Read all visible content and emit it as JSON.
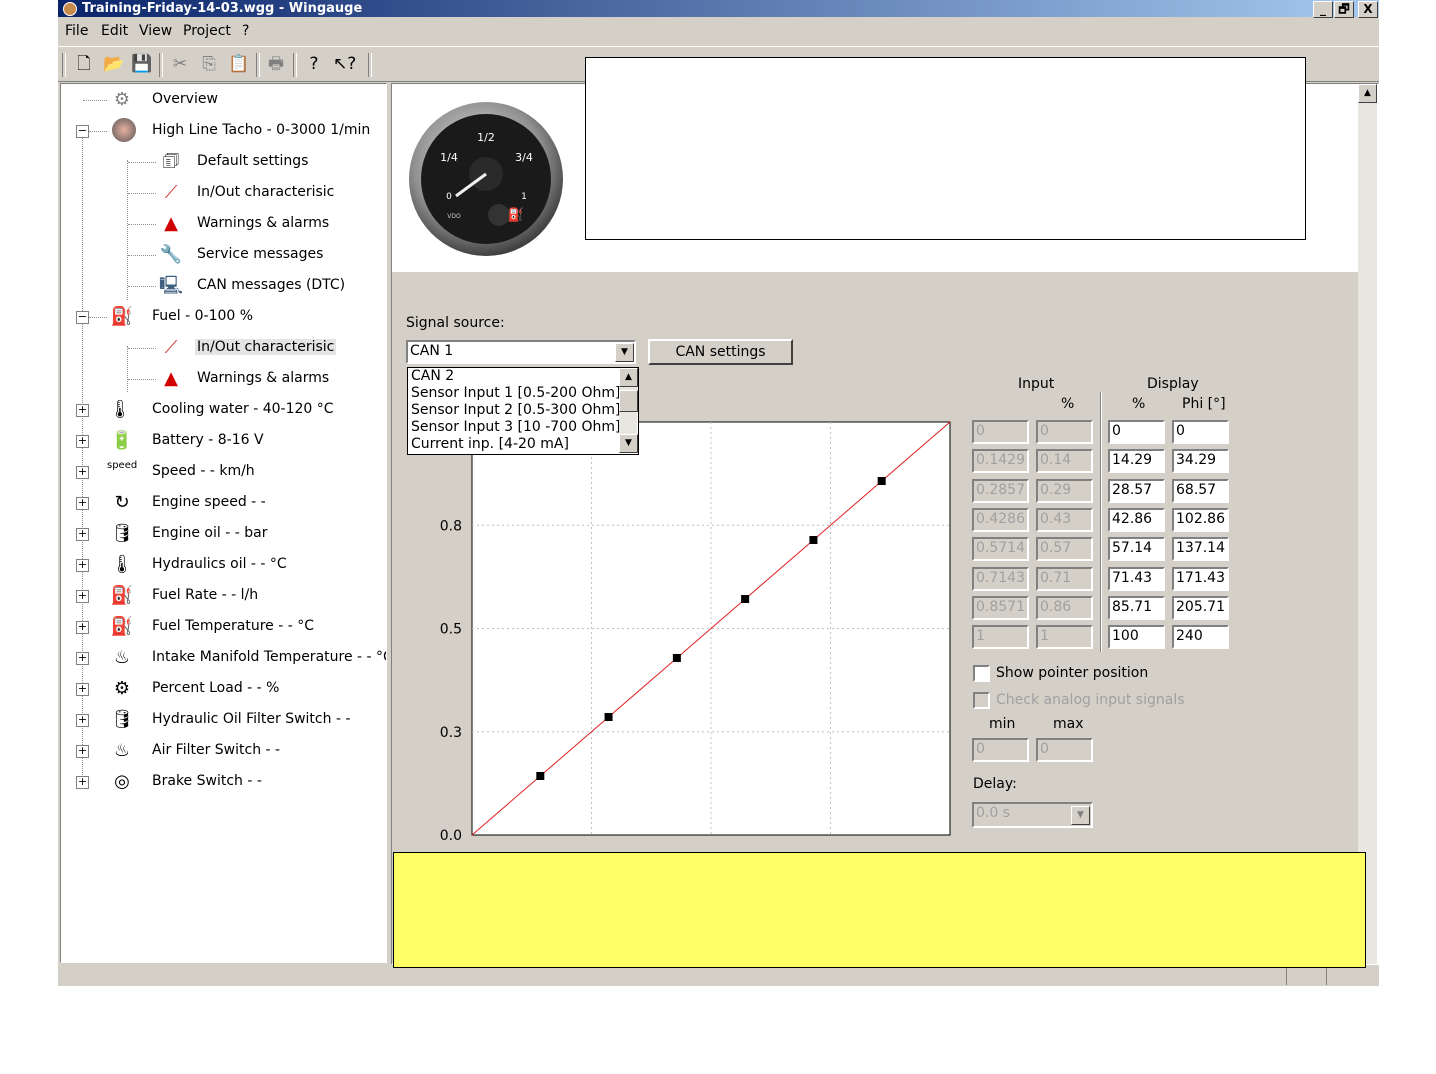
{
  "window": {
    "title": "Training-Friday-14-03.wgg - Wingauge",
    "controls": [
      "_",
      "🗗",
      "X"
    ]
  },
  "menu": [
    "File",
    "Edit",
    "View",
    "Project",
    "?"
  ],
  "toolbar": {
    "icons": [
      "new-icon",
      "open-icon",
      "save-icon",
      "cut-icon",
      "copy-icon",
      "paste-icon",
      "print-icon",
      "help-icon",
      "context-help-icon"
    ]
  },
  "tree": {
    "overview": "Overview",
    "tacho": "High Line Tacho - 0-3000 1/min",
    "tacho_children": [
      "Default settings",
      "In/Out characterisic",
      "Warnings & alarms",
      "Service messages",
      "CAN messages (DTC)"
    ],
    "fuel": "Fuel - 0-100 %",
    "fuel_children": [
      "In/Out characterisic",
      "Warnings & alarms"
    ],
    "others": [
      "Cooling water - 40-120 °C",
      "Battery - 8-16 V",
      "Speed - - km/h",
      "Engine speed - -",
      "Engine oil - - bar",
      "Hydraulics oil - - °C",
      "Fuel Rate - - l/h",
      "Fuel Temperature - - °C",
      "Intake Manifold Temperature - - °C",
      "Percent Load - - %",
      "Hydraulic Oil Filter Switch - -",
      "Air Filter Switch - -",
      "Brake Switch - -"
    ],
    "speed_icon_text": "speed"
  },
  "gauge": {
    "labels": [
      "1/2",
      "1/4",
      "3/4",
      "0",
      "1"
    ],
    "brand": "VDO"
  },
  "signal": {
    "label": "Signal source:",
    "selected": "CAN 1",
    "options": [
      "CAN 2",
      "Sensor Input 1 [0.5-200 Ohm]",
      "Sensor Input 2 [0.5-300 Ohm]",
      "Sensor Input 3 [10 -700 Ohm]",
      "Current inp. [4-20 mA]"
    ],
    "can_settings": "CAN settings"
  },
  "table": {
    "input_header": "Input",
    "display_header": "Display",
    "pct": "%",
    "phi": "Phi [°]",
    "input_raw": [
      "0",
      "0.1429",
      "0.2857",
      "0.4286",
      "0.5714",
      "0.7143",
      "0.8571",
      "1"
    ],
    "input_pct": [
      "0",
      "0.14",
      "0.29",
      "0.43",
      "0.57",
      "0.71",
      "0.86",
      "1"
    ],
    "display_pct": [
      "0",
      "14.29",
      "28.57",
      "42.86",
      "57.14",
      "71.43",
      "85.71",
      "100"
    ],
    "display_phi": [
      "0",
      "34.29",
      "68.57",
      "102.86",
      "137.14",
      "171.43",
      "205.71",
      "240"
    ]
  },
  "options": {
    "show_pointer": "Show pointer position",
    "check_analog": "Check analog input signals",
    "min_label": "min",
    "max_label": "max",
    "min_value": "0",
    "max_value": "0",
    "delay_label": "Delay:",
    "delay_value": "0.0 s"
  },
  "chart_data": {
    "type": "line",
    "y_ticks": [
      "0.0",
      "0.3",
      "0.5",
      "0.8"
    ],
    "x": [
      0,
      0.1429,
      0.2857,
      0.4286,
      0.5714,
      0.7143,
      0.8571,
      1
    ],
    "y": [
      0,
      0.1429,
      0.2857,
      0.4286,
      0.5714,
      0.7143,
      0.8571,
      1
    ],
    "xlim": [
      0,
      1
    ],
    "ylim": [
      0,
      1
    ],
    "grid": true,
    "line_color": "#e02020"
  }
}
